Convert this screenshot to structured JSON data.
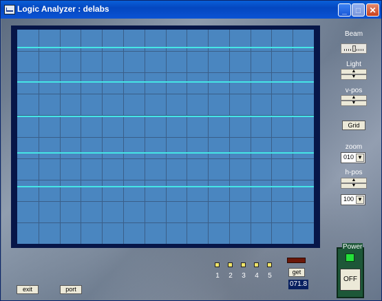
{
  "window": {
    "title": "Logic Analyzer : delabs",
    "controls": {
      "minimize": "_",
      "maximize": "□",
      "close": "✕"
    }
  },
  "scope": {
    "grid_columns": 14,
    "grid_rows": 10,
    "trace_color": "#45e6e6",
    "screen_color": "#4a86c0"
  },
  "side_panel": {
    "beam_label": "Beam",
    "light_label": "Light",
    "vpos_label": "v-pos",
    "grid_button": "Grid",
    "zoom_label": "zoom",
    "zoom_value": "010",
    "hpos_label": "h-pos",
    "hpos_value": "100"
  },
  "channels": [
    "1",
    "2",
    "3",
    "4",
    "5"
  ],
  "get_button": "get",
  "readout": "071.8",
  "power": {
    "label": "Power",
    "button": "OFF",
    "led_color": "#24e03a"
  },
  "buttons": {
    "exit": "exit",
    "port": "port"
  }
}
